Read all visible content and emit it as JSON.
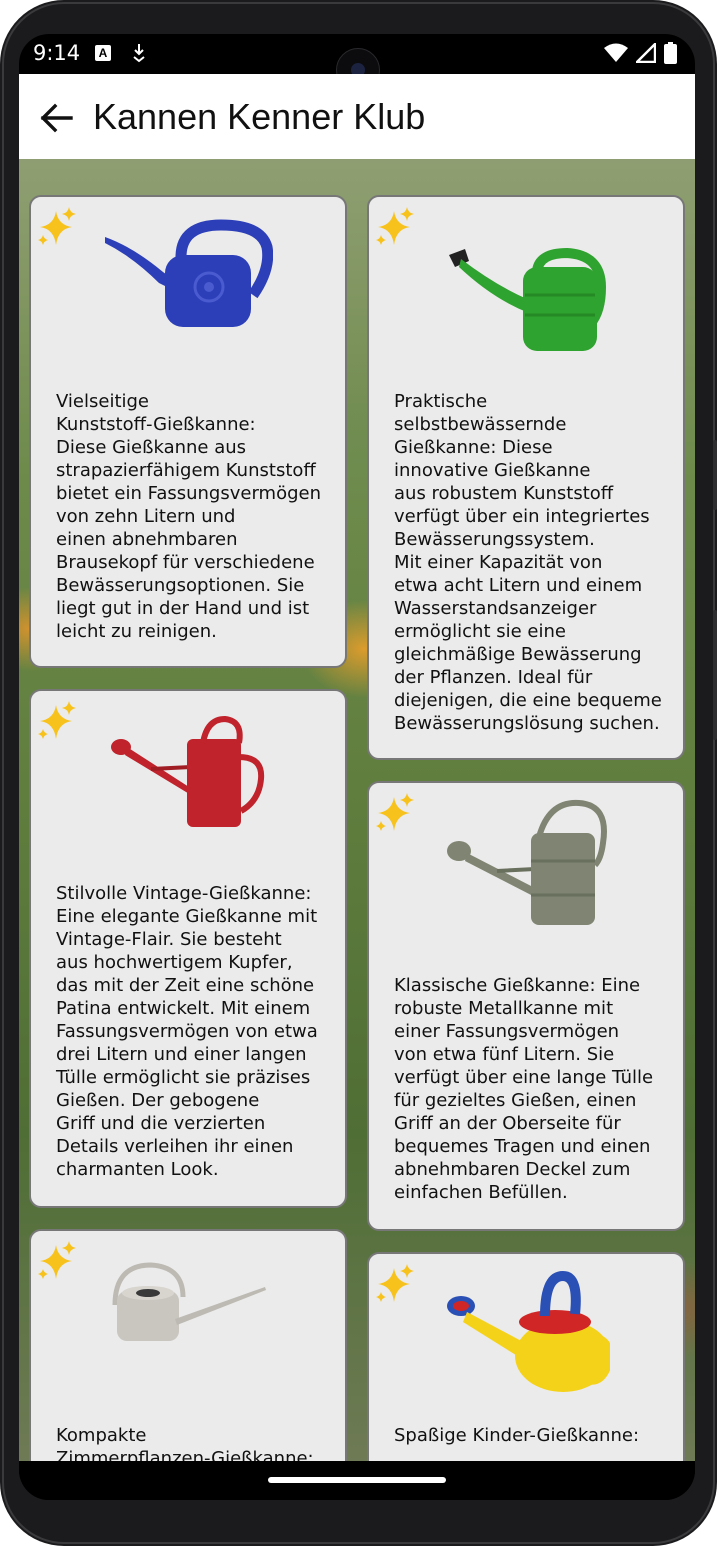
{
  "status_bar": {
    "time": "9:14",
    "notification_icons": [
      "a-icon",
      "download-icon"
    ],
    "system_icons": [
      "wifi-icon",
      "signal-icon",
      "battery-icon"
    ]
  },
  "app_bar": {
    "title": "Kannen Kenner Klub",
    "back_icon": "arrow-back-icon"
  },
  "cards": [
    {
      "id": "card-1",
      "badge_icon": "sparkles-icon",
      "image": "blue-plastic-watering-can",
      "image_color": "#2c3fb8",
      "lines": [
        "Vielseitige",
        "Kunststoff-Gießkanne:",
        "Diese Gießkanne aus",
        "strapazierfähigem Kunststoff",
        "bietet ein Fassungsvermögen",
        "von zehn Litern und",
        "einen abnehmbaren",
        "Brausekopf für verschiedene",
        "Bewässerungsoptionen. Sie",
        "liegt gut in der Hand und ist",
        "leicht zu reinigen."
      ]
    },
    {
      "id": "card-2",
      "badge_icon": "sparkles-icon",
      "image": "green-watering-can",
      "image_color": "#2fa32f",
      "lines": [
        "Praktische",
        "selbstbewässernde",
        "Gießkanne: Diese",
        "innovative Gießkanne",
        "aus robustem Kunststoff",
        "verfügt über ein integriertes",
        "Bewässerungssystem.",
        "Mit einer Kapazität von",
        "etwa acht Litern und einem",
        "Wasserstandsanzeiger",
        "ermöglicht sie eine",
        "gleichmäßige Bewässerung",
        "der Pflanzen. Ideal für",
        "diejenigen, die eine bequeme",
        "Bewässerungslösung suchen."
      ]
    },
    {
      "id": "card-3",
      "badge_icon": "sparkles-icon",
      "image": "red-vintage-watering-can",
      "image_color": "#c0232b",
      "lines": [
        "Stilvolle Vintage-Gießkanne:",
        "Eine elegante Gießkanne mit",
        "Vintage-Flair. Sie besteht",
        "aus hochwertigem Kupfer,",
        "das mit der Zeit eine schöne",
        "Patina entwickelt. Mit einem",
        "Fassungsvermögen von etwa",
        "drei Litern und einer langen",
        "Tülle ermöglicht sie präzises",
        "Gießen. Der gebogene",
        "Griff und die verzierten",
        "Details verleihen ihr einen",
        "charmanten Look."
      ]
    },
    {
      "id": "card-4",
      "badge_icon": "sparkles-icon",
      "image": "metal-classic-watering-can",
      "image_color": "#7f8572",
      "lines": [
        "Klassische Gießkanne: Eine",
        "robuste Metallkanne mit",
        "einer Fassungsvermögen",
        "von etwa fünf Litern. Sie",
        "verfügt über eine lange Tülle",
        "für gezieltes Gießen, einen",
        "Griff an der Oberseite für",
        "bequemes Tragen und einen",
        "abnehmbaren Deckel zum",
        "einfachen Befüllen."
      ]
    },
    {
      "id": "card-5",
      "badge_icon": "sparkles-icon",
      "image": "stainless-indoor-watering-can",
      "image_color": "#c9c6c0",
      "lines": [
        "Kompakte",
        "Zimmerpflanzen-Gießkanne:"
      ]
    },
    {
      "id": "card-6",
      "badge_icon": "sparkles-icon",
      "image": "kids-watering-can",
      "image_color": "#f5d21a",
      "lines": [
        "Spaßige Kinder-Gießkanne:"
      ]
    }
  ]
}
